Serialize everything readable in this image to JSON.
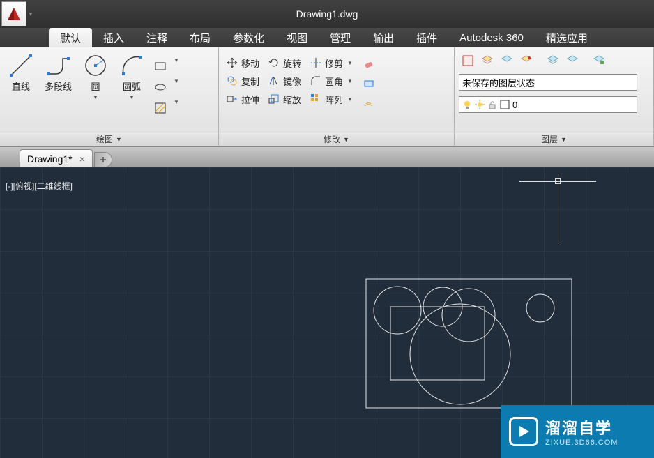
{
  "title": "Drawing1.dwg",
  "menu": {
    "tabs": [
      "默认",
      "插入",
      "注释",
      "布局",
      "参数化",
      "视图",
      "管理",
      "输出",
      "插件",
      "Autodesk 360",
      "精选应用"
    ],
    "activeIndex": 0
  },
  "ribbon": {
    "draw": {
      "title": "绘图",
      "line": "直线",
      "polyline": "多段线",
      "circle": "圆",
      "arc": "圆弧"
    },
    "modify": {
      "title": "修改",
      "move": "移动",
      "rotate": "旋转",
      "trim": "修剪",
      "copy": "复制",
      "mirror": "镜像",
      "fillet": "圆角",
      "stretch": "拉伸",
      "scale": "缩放",
      "array": "阵列"
    },
    "layers": {
      "title": "图层",
      "unsaved": "未保存的图层状态",
      "current": "0"
    }
  },
  "doctab": {
    "name": "Drawing1*"
  },
  "viewport": {
    "label": "[-][俯视][二维线框]"
  },
  "watermark": {
    "title": "溜溜自学",
    "url": "ZIXUE.3D66.COM"
  }
}
